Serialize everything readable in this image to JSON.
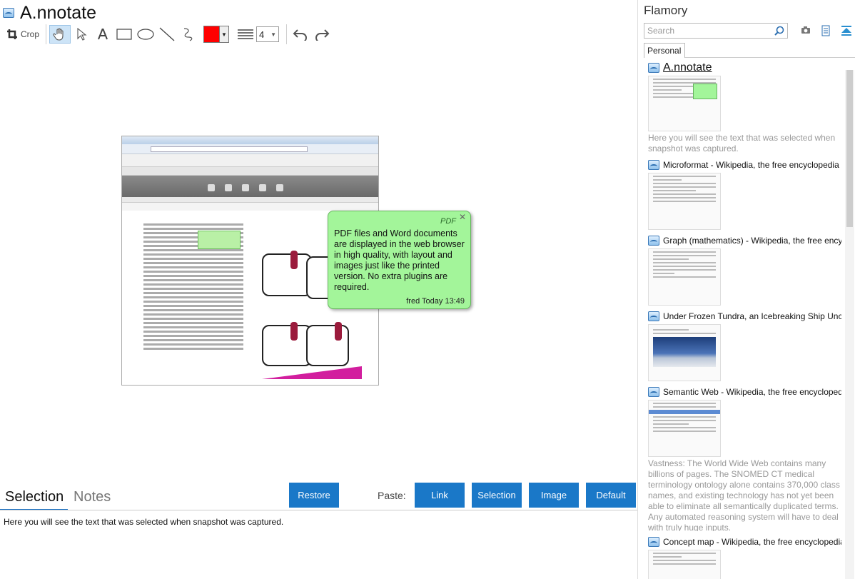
{
  "app": {
    "title": "A.nnotate"
  },
  "toolbar": {
    "crop_label": "Crop",
    "line_width_value": "4",
    "stroke_color": "#ff0000"
  },
  "note": {
    "type": "PDF",
    "body": "PDF files and Word documents are displayed in the web browser in high quality, with layout and images just like the printed version. No extra plugins are required.",
    "meta": "fred Today 13:49"
  },
  "bottom": {
    "tab_selection": "Selection",
    "tab_notes": "Notes",
    "restore_label": "Restore",
    "paste_label": "Paste:",
    "link_label": "Link",
    "selection_btn_label": "Selection",
    "image_label": "Image",
    "default_label": "Default",
    "selection_text": "Here you will see the text that was selected when snapshot was captured."
  },
  "sidebar": {
    "title": "Flamory",
    "search_placeholder": "Search",
    "tab_personal": "Personal",
    "items": [
      {
        "title": "A.nnotate",
        "desc": "Here you will see the text that was selected when snapshot was captured."
      },
      {
        "title": "Microformat - Wikipedia, the free encyclopedia",
        "desc": ""
      },
      {
        "title": "Graph (mathematics) - Wikipedia, the free encyclopedia",
        "desc": ""
      },
      {
        "title": "Under Frozen Tundra, an Icebreaking Ship Uncovers",
        "desc": ""
      },
      {
        "title": "Semantic Web - Wikipedia, the free encyclopedia",
        "desc": "Vastness: The World Wide Web contains many billions of pages. The SNOMED CT medical terminology ontology alone contains 370,000 class names, and existing technology has not yet been able to eliminate all semantically duplicated terms. Any automated reasoning system will have to deal with truly huge inputs."
      },
      {
        "title": "Concept map - Wikipedia, the free encyclopedia",
        "desc": ""
      }
    ]
  },
  "colors": {
    "accent": "#1a78c8",
    "note_bg": "#a3f59a"
  }
}
